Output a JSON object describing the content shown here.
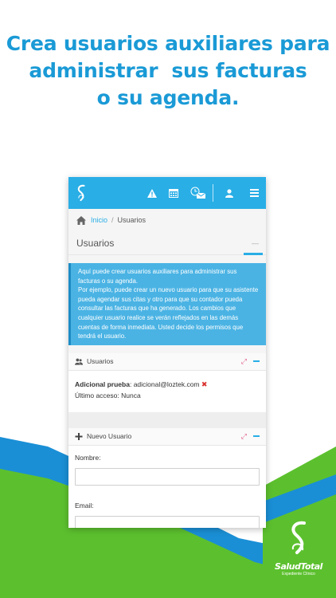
{
  "headline": {
    "line1": "Crea usuarios auxiliares para",
    "line2": "administrar  sus facturas",
    "line3": "o su agenda."
  },
  "colors": {
    "headline": "#1a9ad6",
    "topbar": "#29aee6",
    "info_box": "#4ab3e4",
    "green_bg": "#5cc02e",
    "blue_stripe": "#1a8fd6"
  },
  "topbar": {
    "icons": [
      "salud-total-s-logo",
      "warning-icon",
      "calendar-icon",
      "clock-mail-icon",
      "user-icon",
      "menu-icon"
    ]
  },
  "breadcrumb": {
    "home": "Inicio",
    "separator": "/",
    "current": "Usuarios"
  },
  "page": {
    "title": "Usuarios",
    "title_control": "—"
  },
  "info_text": "Aquí puede crear usuarios auxiliares para administrar sus facturas o su agenda.\nPor ejemplo, puede crear un nuevo usuario para que su asistente pueda agendar sus citas y otro para que su contador pueda consultar las facturas que ha generado. Los cambios que cualquier usuario realice se verán reflejados en las demás cuentas de forma inmediata. Usted decide los permisos que tendrá el usuario.",
  "users_panel": {
    "title": "Usuarios",
    "user_name": "Adicional prueba",
    "user_email": ": adicional@loztek.com",
    "delete_mark": "✖",
    "last_access": "Último acceso: Nunca"
  },
  "new_user_panel": {
    "title": "Nuevo Usuario",
    "fields": [
      {
        "label": "Nombre:",
        "value": ""
      },
      {
        "label": "Email:",
        "value": ""
      }
    ]
  },
  "brand": {
    "name": "SaludTotal",
    "subtitle": "Expediente Clínico"
  }
}
